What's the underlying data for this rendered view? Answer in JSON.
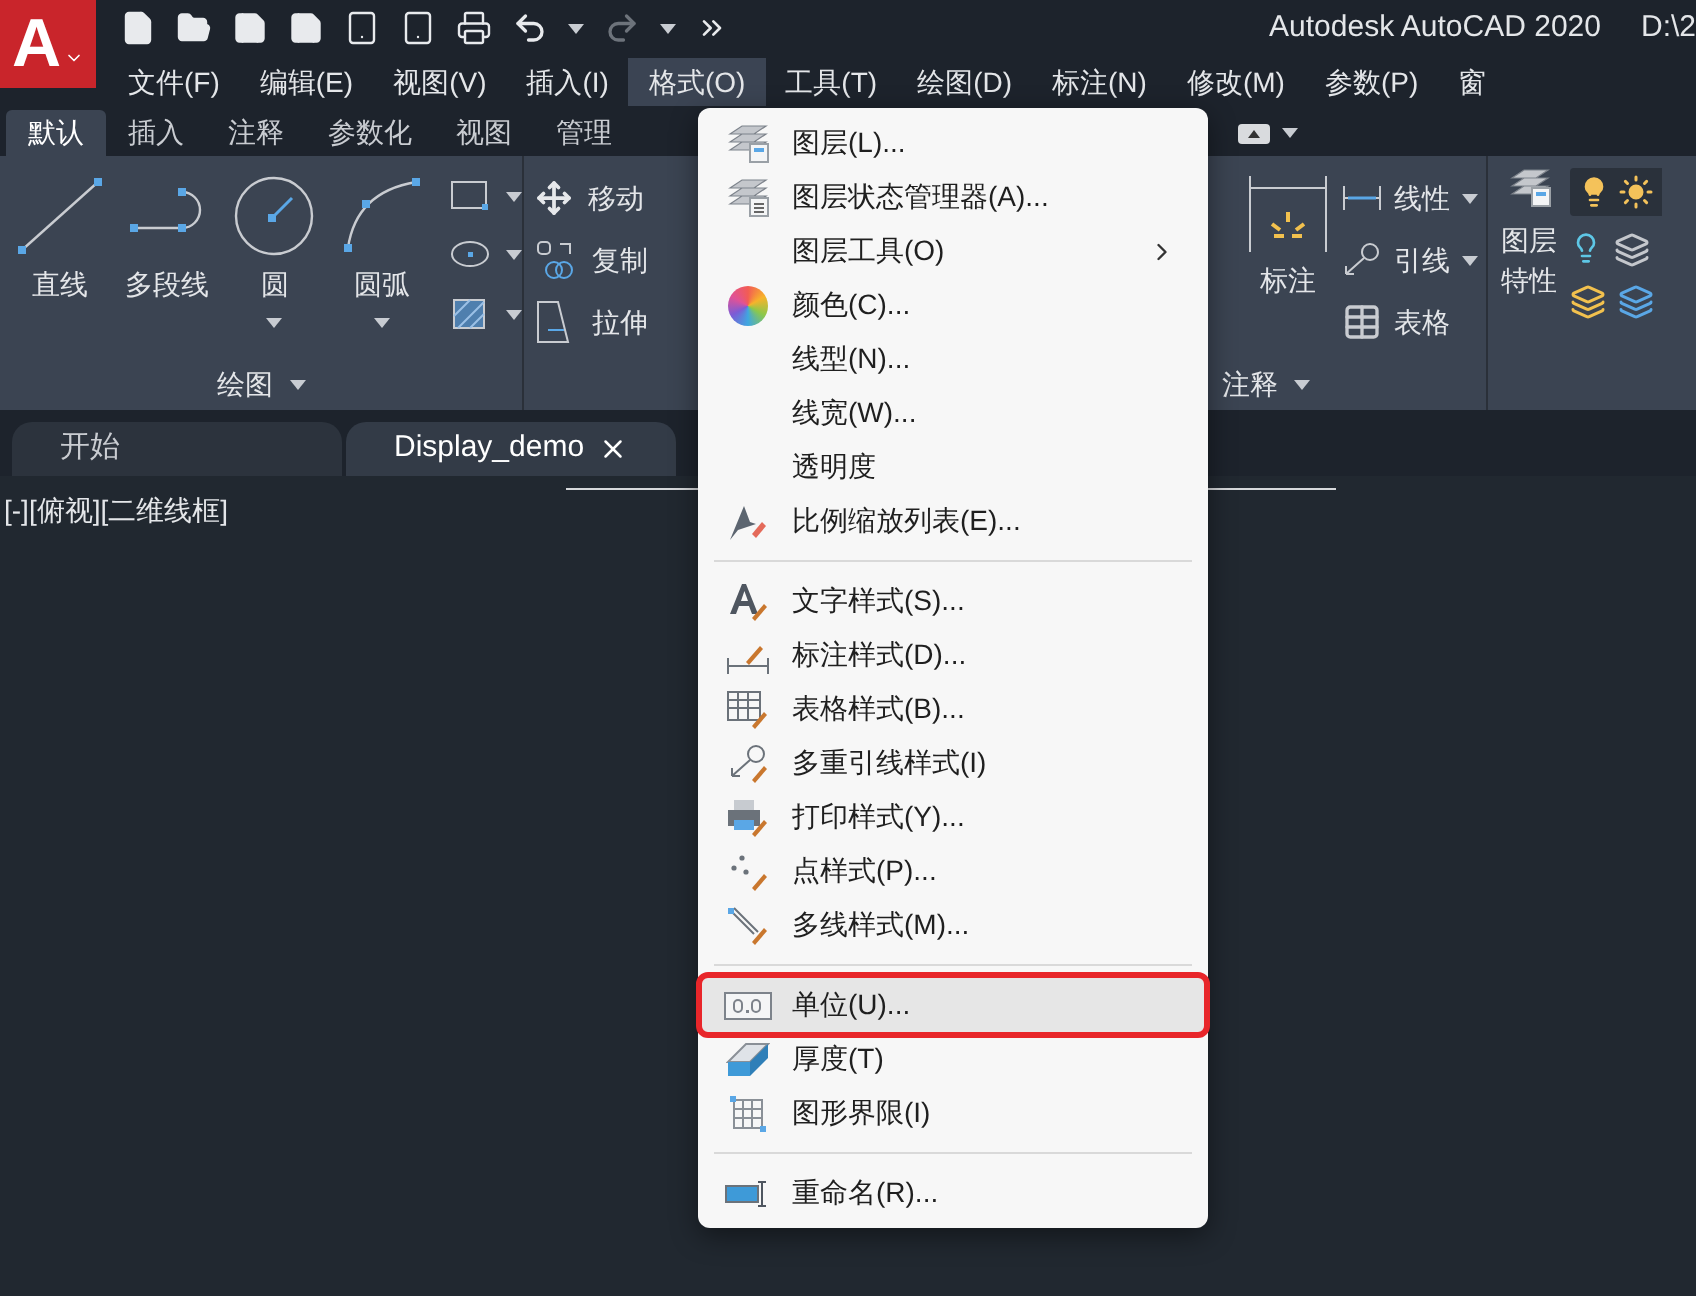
{
  "title_bar": {
    "logo": "A",
    "title": "Autodesk AutoCAD 2020",
    "path": "D:\\2"
  },
  "menu_bar": [
    {
      "label": "文件(F)",
      "selected": false
    },
    {
      "label": "编辑(E)",
      "selected": false
    },
    {
      "label": "视图(V)",
      "selected": false
    },
    {
      "label": "插入(I)",
      "selected": false
    },
    {
      "label": "格式(O)",
      "selected": true
    },
    {
      "label": "工具(T)",
      "selected": false
    },
    {
      "label": "绘图(D)",
      "selected": false
    },
    {
      "label": "标注(N)",
      "selected": false
    },
    {
      "label": "修改(M)",
      "selected": false
    },
    {
      "label": "参数(P)",
      "selected": false
    },
    {
      "label": "窗",
      "selected": false
    }
  ],
  "ribbon_tabs": [
    {
      "label": "默认",
      "selected": true
    },
    {
      "label": "插入",
      "selected": false
    },
    {
      "label": "注释",
      "selected": false
    },
    {
      "label": "参数化",
      "selected": false
    },
    {
      "label": "视图",
      "selected": false
    },
    {
      "label": "管理",
      "selected": false
    }
  ],
  "ribbon": {
    "draw_panel": {
      "title": "绘图",
      "tools": [
        {
          "label": "直线",
          "has_dropdown": false
        },
        {
          "label": "多段线",
          "has_dropdown": false
        },
        {
          "label": "圆",
          "has_dropdown": true
        },
        {
          "label": "圆弧",
          "has_dropdown": true
        }
      ]
    },
    "modify_tools": [
      "移动",
      "复制",
      "拉伸"
    ],
    "annotation_panel": {
      "title": "注释",
      "big_tool": "标注",
      "tools": [
        "线性",
        "引线",
        "表格"
      ]
    },
    "layer_panel": {
      "big_tool": "图层特性"
    }
  },
  "file_tabs": [
    {
      "label": "开始",
      "selected": false,
      "closable": false
    },
    {
      "label": "Display_demo",
      "selected": true,
      "closable": true
    }
  ],
  "viewport": {
    "label": "[-][俯视][二维线框]"
  },
  "format_menu": {
    "items": [
      {
        "kind": "item",
        "label": "图层(L)...",
        "selected": false,
        "has_submenu": false
      },
      {
        "kind": "item",
        "label": "图层状态管理器(A)...",
        "selected": false,
        "has_submenu": false
      },
      {
        "kind": "item",
        "label": "图层工具(O)",
        "selected": false,
        "has_submenu": true
      },
      {
        "kind": "item",
        "label": "颜色(C)...",
        "selected": false,
        "has_submenu": false
      },
      {
        "kind": "item",
        "label": "线型(N)...",
        "selected": false,
        "has_submenu": false
      },
      {
        "kind": "item",
        "label": "线宽(W)...",
        "selected": false,
        "has_submenu": false
      },
      {
        "kind": "item",
        "label": "透明度",
        "selected": false,
        "has_submenu": false
      },
      {
        "kind": "item",
        "label": "比例缩放列表(E)...",
        "selected": false,
        "has_submenu": false
      },
      {
        "kind": "separator"
      },
      {
        "kind": "item",
        "label": "文字样式(S)...",
        "selected": false,
        "has_submenu": false
      },
      {
        "kind": "item",
        "label": "标注样式(D)...",
        "selected": false,
        "has_submenu": false
      },
      {
        "kind": "item",
        "label": "表格样式(B)...",
        "selected": false,
        "has_submenu": false
      },
      {
        "kind": "item",
        "label": "多重引线样式(I)",
        "selected": false,
        "has_submenu": false
      },
      {
        "kind": "item",
        "label": "打印样式(Y)...",
        "selected": false,
        "has_submenu": false
      },
      {
        "kind": "item",
        "label": "点样式(P)...",
        "selected": false,
        "has_submenu": false
      },
      {
        "kind": "item",
        "label": "多线样式(M)...",
        "selected": false,
        "has_submenu": false
      },
      {
        "kind": "separator"
      },
      {
        "kind": "item",
        "label": "单位(U)...",
        "selected": true,
        "has_submenu": false
      },
      {
        "kind": "item",
        "label": "厚度(T)",
        "selected": false,
        "has_submenu": false
      },
      {
        "kind": "item",
        "label": "图形界限(I)",
        "selected": false,
        "has_submenu": false
      },
      {
        "kind": "separator"
      },
      {
        "kind": "item",
        "label": "重命名(R)...",
        "selected": false,
        "has_submenu": false
      }
    ]
  }
}
